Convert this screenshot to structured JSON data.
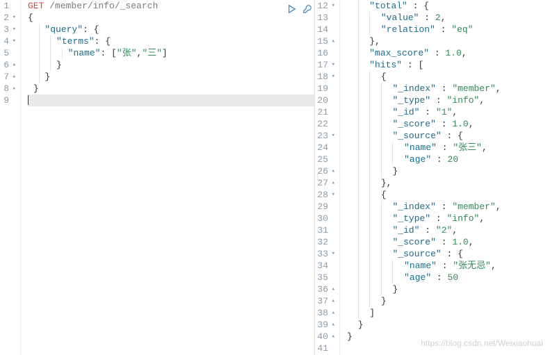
{
  "left": {
    "lines": [
      {
        "n": 1,
        "fold": "",
        "tokens": [
          [
            "method",
            "GET"
          ],
          [
            "plain",
            " "
          ],
          [
            "path",
            "/member/info/_search"
          ]
        ]
      },
      {
        "n": 2,
        "fold": "▾",
        "tokens": [
          [
            "brace",
            "{"
          ]
        ]
      },
      {
        "n": 3,
        "fold": "▾",
        "tokens": [
          [
            "plain",
            "   "
          ],
          [
            "key",
            "\"query\""
          ],
          [
            "punc",
            ": "
          ],
          [
            "brace",
            "{"
          ]
        ]
      },
      {
        "n": 4,
        "fold": "▾",
        "tokens": [
          [
            "plain",
            "     "
          ],
          [
            "key",
            "\"terms\""
          ],
          [
            "punc",
            ": "
          ],
          [
            "brace",
            "{"
          ]
        ]
      },
      {
        "n": 5,
        "fold": "",
        "tokens": [
          [
            "plain",
            "       "
          ],
          [
            "key",
            "\"name\""
          ],
          [
            "punc",
            ": ["
          ],
          [
            "str",
            "\"张\""
          ],
          [
            "punc",
            ","
          ],
          [
            "str",
            "\"三\""
          ],
          [
            "punc",
            "]"
          ]
        ]
      },
      {
        "n": 6,
        "fold": "▴",
        "tokens": [
          [
            "plain",
            "     "
          ],
          [
            "brace",
            "}"
          ]
        ]
      },
      {
        "n": 7,
        "fold": "▴",
        "tokens": [
          [
            "plain",
            "   "
          ],
          [
            "brace",
            "}"
          ]
        ]
      },
      {
        "n": 8,
        "fold": "▴",
        "tokens": [
          [
            "plain",
            " "
          ],
          [
            "brace",
            "}"
          ]
        ]
      },
      {
        "n": 9,
        "fold": "",
        "hl": true,
        "tokens": [
          [
            "plain",
            ""
          ]
        ]
      }
    ]
  },
  "right": {
    "lines": [
      {
        "n": 12,
        "fold": "▾",
        "tokens": [
          [
            "plain",
            "    "
          ],
          [
            "key",
            "\"total\""
          ],
          [
            "punc",
            " : "
          ],
          [
            "brace",
            "{"
          ]
        ]
      },
      {
        "n": 13,
        "fold": "",
        "tokens": [
          [
            "plain",
            "      "
          ],
          [
            "key",
            "\"value\""
          ],
          [
            "punc",
            " : "
          ],
          [
            "num",
            "2"
          ],
          [
            "punc",
            ","
          ]
        ]
      },
      {
        "n": 14,
        "fold": "",
        "tokens": [
          [
            "plain",
            "      "
          ],
          [
            "key",
            "\"relation\""
          ],
          [
            "punc",
            " : "
          ],
          [
            "str",
            "\"eq\""
          ]
        ]
      },
      {
        "n": 15,
        "fold": "▴",
        "tokens": [
          [
            "plain",
            "    "
          ],
          [
            "brace",
            "}"
          ],
          [
            "punc",
            ","
          ]
        ]
      },
      {
        "n": 16,
        "fold": "",
        "tokens": [
          [
            "plain",
            "    "
          ],
          [
            "key",
            "\"max_score\""
          ],
          [
            "punc",
            " : "
          ],
          [
            "num",
            "1.0"
          ],
          [
            "punc",
            ","
          ]
        ]
      },
      {
        "n": 17,
        "fold": "▾",
        "tokens": [
          [
            "plain",
            "    "
          ],
          [
            "key",
            "\"hits\""
          ],
          [
            "punc",
            " : ["
          ]
        ]
      },
      {
        "n": 18,
        "fold": "▾",
        "tokens": [
          [
            "plain",
            "      "
          ],
          [
            "brace",
            "{"
          ]
        ]
      },
      {
        "n": 19,
        "fold": "",
        "tokens": [
          [
            "plain",
            "        "
          ],
          [
            "key",
            "\"_index\""
          ],
          [
            "punc",
            " : "
          ],
          [
            "str",
            "\"member\""
          ],
          [
            "punc",
            ","
          ]
        ]
      },
      {
        "n": 20,
        "fold": "",
        "tokens": [
          [
            "plain",
            "        "
          ],
          [
            "key",
            "\"_type\""
          ],
          [
            "punc",
            " : "
          ],
          [
            "str",
            "\"info\""
          ],
          [
            "punc",
            ","
          ]
        ]
      },
      {
        "n": 21,
        "fold": "",
        "tokens": [
          [
            "plain",
            "        "
          ],
          [
            "key",
            "\"_id\""
          ],
          [
            "punc",
            " : "
          ],
          [
            "str",
            "\"1\""
          ],
          [
            "punc",
            ","
          ]
        ]
      },
      {
        "n": 22,
        "fold": "",
        "tokens": [
          [
            "plain",
            "        "
          ],
          [
            "key",
            "\"_score\""
          ],
          [
            "punc",
            " : "
          ],
          [
            "num",
            "1.0"
          ],
          [
            "punc",
            ","
          ]
        ]
      },
      {
        "n": 23,
        "fold": "▾",
        "tokens": [
          [
            "plain",
            "        "
          ],
          [
            "key",
            "\"_source\""
          ],
          [
            "punc",
            " : "
          ],
          [
            "brace",
            "{"
          ]
        ]
      },
      {
        "n": 24,
        "fold": "",
        "tokens": [
          [
            "plain",
            "          "
          ],
          [
            "key",
            "\"name\""
          ],
          [
            "punc",
            " : "
          ],
          [
            "str",
            "\"张三\""
          ],
          [
            "punc",
            ","
          ]
        ]
      },
      {
        "n": 25,
        "fold": "",
        "tokens": [
          [
            "plain",
            "          "
          ],
          [
            "key",
            "\"age\""
          ],
          [
            "punc",
            " : "
          ],
          [
            "num",
            "20"
          ]
        ]
      },
      {
        "n": 26,
        "fold": "▴",
        "tokens": [
          [
            "plain",
            "        "
          ],
          [
            "brace",
            "}"
          ]
        ]
      },
      {
        "n": 27,
        "fold": "▴",
        "tokens": [
          [
            "plain",
            "      "
          ],
          [
            "brace",
            "}"
          ],
          [
            "punc",
            ","
          ]
        ]
      },
      {
        "n": 28,
        "fold": "▾",
        "tokens": [
          [
            "plain",
            "      "
          ],
          [
            "brace",
            "{"
          ]
        ]
      },
      {
        "n": 29,
        "fold": "",
        "tokens": [
          [
            "plain",
            "        "
          ],
          [
            "key",
            "\"_index\""
          ],
          [
            "punc",
            " : "
          ],
          [
            "str",
            "\"member\""
          ],
          [
            "punc",
            ","
          ]
        ]
      },
      {
        "n": 30,
        "fold": "",
        "tokens": [
          [
            "plain",
            "        "
          ],
          [
            "key",
            "\"_type\""
          ],
          [
            "punc",
            " : "
          ],
          [
            "str",
            "\"info\""
          ],
          [
            "punc",
            ","
          ]
        ]
      },
      {
        "n": 31,
        "fold": "",
        "tokens": [
          [
            "plain",
            "        "
          ],
          [
            "key",
            "\"_id\""
          ],
          [
            "punc",
            " : "
          ],
          [
            "str",
            "\"2\""
          ],
          [
            "punc",
            ","
          ]
        ]
      },
      {
        "n": 32,
        "fold": "",
        "tokens": [
          [
            "plain",
            "        "
          ],
          [
            "key",
            "\"_score\""
          ],
          [
            "punc",
            " : "
          ],
          [
            "num",
            "1.0"
          ],
          [
            "punc",
            ","
          ]
        ]
      },
      {
        "n": 33,
        "fold": "▾",
        "tokens": [
          [
            "plain",
            "        "
          ],
          [
            "key",
            "\"_source\""
          ],
          [
            "punc",
            " : "
          ],
          [
            "brace",
            "{"
          ]
        ]
      },
      {
        "n": 34,
        "fold": "",
        "tokens": [
          [
            "plain",
            "          "
          ],
          [
            "key",
            "\"name\""
          ],
          [
            "punc",
            " : "
          ],
          [
            "str",
            "\"张无忌\""
          ],
          [
            "punc",
            ","
          ]
        ]
      },
      {
        "n": 35,
        "fold": "",
        "tokens": [
          [
            "plain",
            "          "
          ],
          [
            "key",
            "\"age\""
          ],
          [
            "punc",
            " : "
          ],
          [
            "num",
            "50"
          ]
        ]
      },
      {
        "n": 36,
        "fold": "▴",
        "tokens": [
          [
            "plain",
            "        "
          ],
          [
            "brace",
            "}"
          ]
        ]
      },
      {
        "n": 37,
        "fold": "▴",
        "tokens": [
          [
            "plain",
            "      "
          ],
          [
            "brace",
            "}"
          ]
        ]
      },
      {
        "n": 38,
        "fold": "▴",
        "tokens": [
          [
            "plain",
            "    "
          ],
          [
            "punc",
            "]"
          ]
        ]
      },
      {
        "n": 39,
        "fold": "▴",
        "tokens": [
          [
            "plain",
            "  "
          ],
          [
            "brace",
            "}"
          ]
        ]
      },
      {
        "n": 40,
        "fold": "▴",
        "tokens": [
          [
            "brace",
            "}"
          ]
        ]
      },
      {
        "n": 41,
        "fold": "",
        "tokens": [
          [
            "plain",
            ""
          ]
        ]
      }
    ]
  },
  "watermark": "https://blog.csdn.net/Weixiaohuai"
}
